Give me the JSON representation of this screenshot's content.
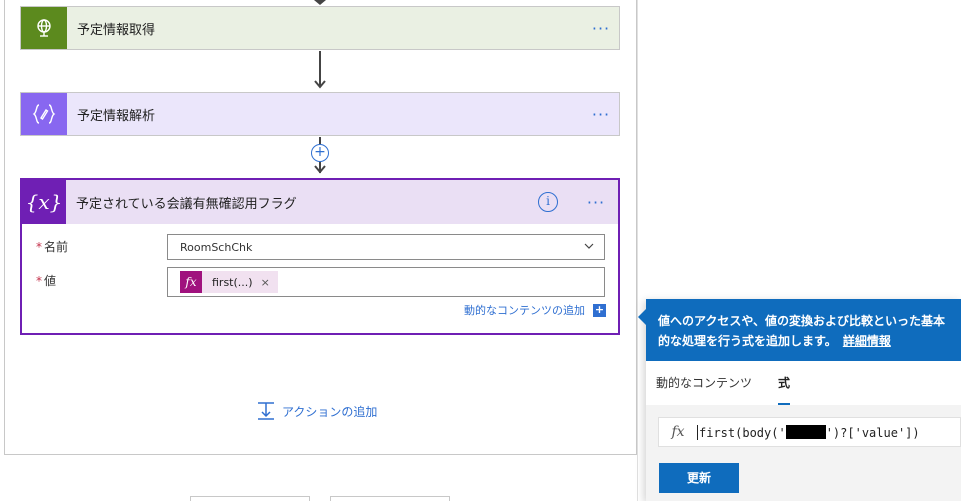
{
  "flow": {
    "step1": {
      "title": "予定情報取得",
      "more": "···",
      "icon": "globe-icon"
    },
    "step2": {
      "title": "予定情報解析",
      "more": "···",
      "icon": "braces-edit-icon"
    },
    "insert_symbol": "+",
    "step3": {
      "title": "予定されている会議有無確認用フラグ",
      "info_symbol": "i",
      "more": "···",
      "icon": "variable-icon",
      "icon_text": "{x}",
      "name_label": "名前",
      "name_value": "RoomSchChk",
      "value_label": "値",
      "required_mark": "*",
      "token_icon_text": "fx",
      "token_label": "first(...)",
      "token_remove": "×",
      "add_dynamic": "動的なコンテンツの追加",
      "add_dynamic_symbol": "+"
    },
    "add_action": "アクションの追加"
  },
  "popup": {
    "banner_text": "値へのアクセスや、値の変換および比較といった基本的な処理を行う式を追加します。",
    "more_link": "詳細情報",
    "tabs": [
      {
        "label": "動的なコンテンツ",
        "active": false
      },
      {
        "label": "式",
        "active": true
      }
    ],
    "fx_symbol": "fx",
    "expression_before": "first(body('",
    "expression_after": "')?['value'])",
    "update_button": "更新"
  },
  "colors": {
    "accent": "#0f6cbd",
    "variable_purple": "#6f1fb4",
    "expression_magenta": "#a0127e",
    "http_green": "#5c8a1e",
    "parse_violet": "#8867f0"
  }
}
